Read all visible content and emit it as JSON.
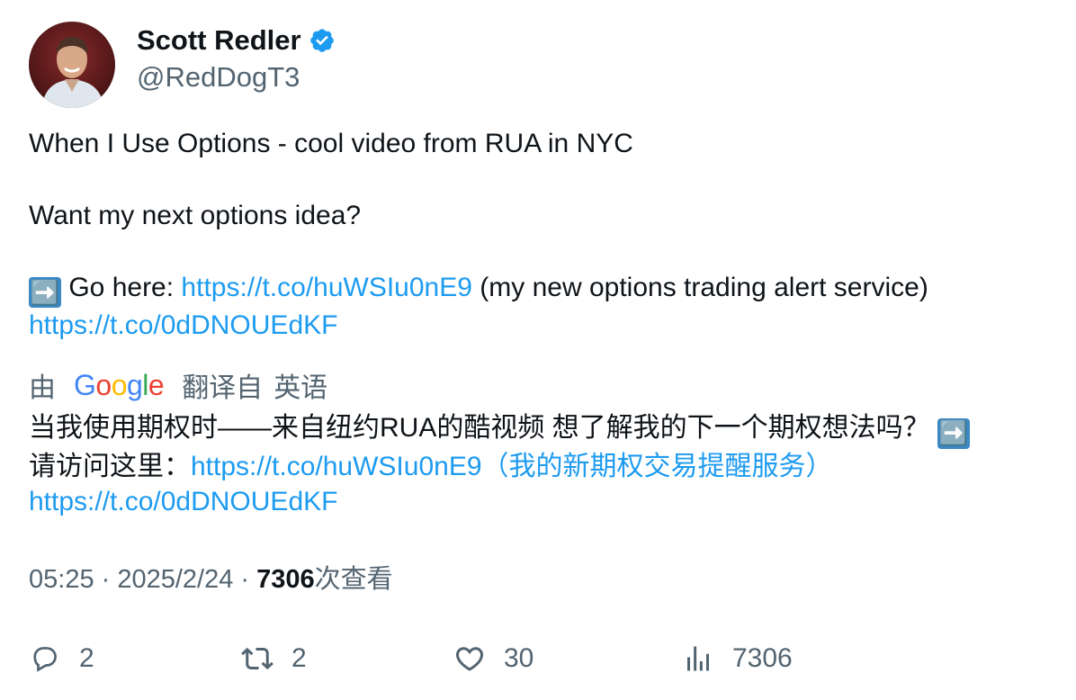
{
  "author": {
    "display_name": "Scott Redler",
    "handle": "@RedDogT3",
    "verified": true,
    "avatar_icon": "profile-photo"
  },
  "tweet": {
    "line1": "When I Use Options - cool video from RUA in NYC",
    "line2": "Want my next options idea?",
    "line3_emoji": "➡️",
    "line3_prefix": "Go here: ",
    "link1": "https://t.co/huWSIu0nE9",
    "line3_suffix": " (my new options trading alert service)",
    "link2": "https://t.co/0dDNOUEdKF"
  },
  "translation": {
    "by_label": "由",
    "provider": "Google",
    "translated_from": "翻译自",
    "language": "英语",
    "text_part1": "当我使用期权时——来自纽约RUA的酷视频 想了解我的下一个期权想法吗？ ",
    "emoji": "➡️",
    "text_part2": "请访问这里：",
    "link1": "https://t.co/huWSIu0nE9",
    "link1_suffix": "（我的新期权交易提醒服务）",
    "link2": "https://t.co/0dDNOUEdKF"
  },
  "meta": {
    "time": "05:25",
    "separator": " · ",
    "date": "2025/2/24",
    "views_count": "7306",
    "views_label": "次查看"
  },
  "actions": {
    "replies": "2",
    "retweets": "2",
    "likes": "30",
    "views": "7306"
  },
  "colors": {
    "link": "#1d9bf0",
    "secondary_text": "#536471",
    "primary_text": "#0f1419",
    "verified_badge": "#1d9bf0"
  }
}
